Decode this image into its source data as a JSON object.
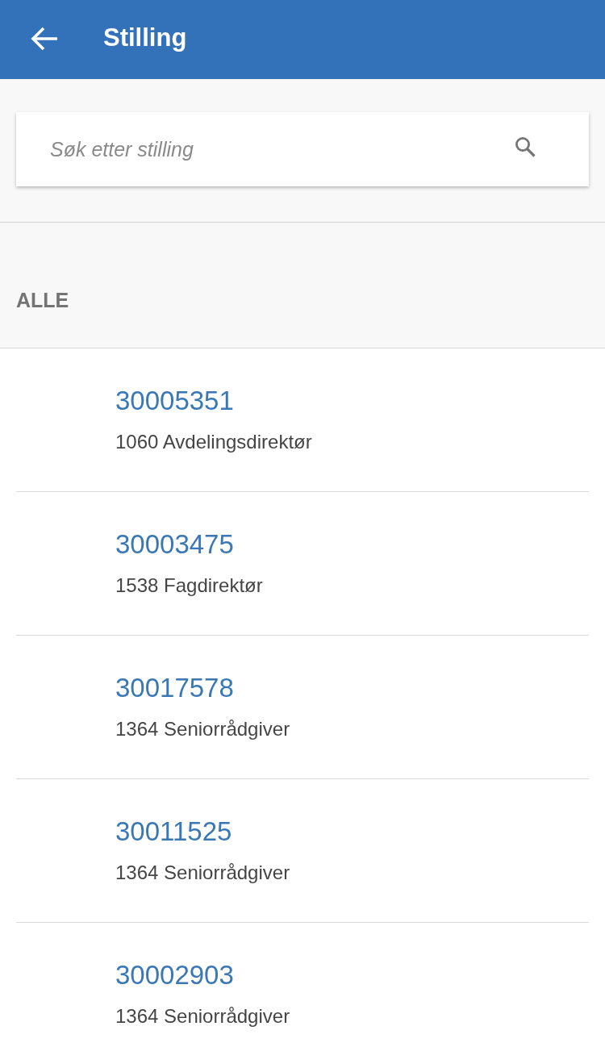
{
  "header": {
    "title": "Stilling"
  },
  "search": {
    "placeholder": "Søk etter stilling"
  },
  "section": {
    "heading": "ALLE"
  },
  "positions": [
    {
      "number": "30005351",
      "title": "1060 Avdelingsdirektør"
    },
    {
      "number": "30003475",
      "title": "1538 Fagdirektør"
    },
    {
      "number": "30017578",
      "title": "1364 Seniorrådgiver"
    },
    {
      "number": "30011525",
      "title": "1364 Seniorrådgiver"
    },
    {
      "number": "30002903",
      "title": "1364 Seniorrådgiver"
    }
  ]
}
